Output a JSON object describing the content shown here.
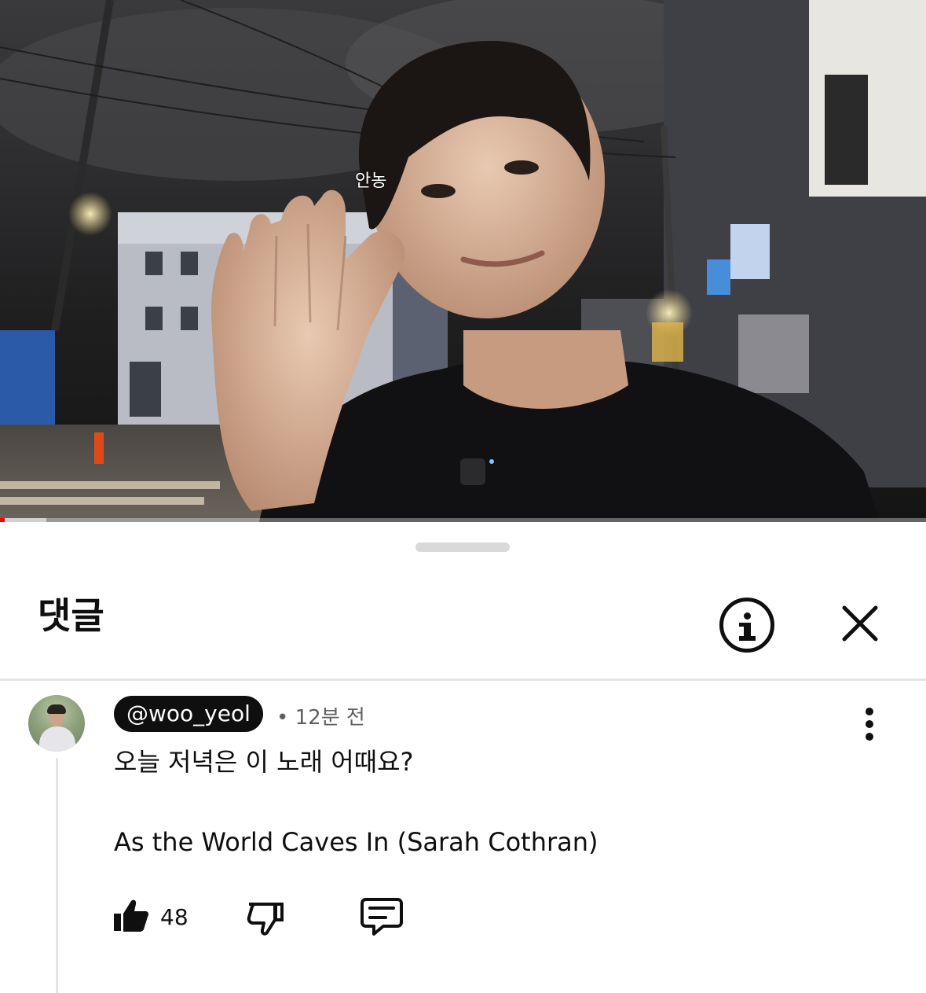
{
  "video": {
    "caption": "안농",
    "progress_fraction": 0.005,
    "buffered_fraction": 0.05
  },
  "sheet": {
    "title": "댓글",
    "info_icon": "info-icon",
    "close_icon": "close-icon"
  },
  "comment": {
    "handle": "@woo_yeol",
    "separator": "•",
    "time_ago": "12분 전",
    "text_line1": "오늘 저녁은 이 노래 어때요?",
    "text_line2": "As the World Caves In (Sarah Cothran)",
    "like_count": "48",
    "like_icon": "thumbs-up-icon",
    "dislike_icon": "thumbs-down-icon",
    "reply_icon": "reply-icon",
    "more_icon": "more-vert-icon"
  },
  "colors": {
    "progress": "#ff0000",
    "text_primary": "#0f0f0f",
    "text_secondary": "#606060",
    "divider": "#e5e5e5"
  }
}
